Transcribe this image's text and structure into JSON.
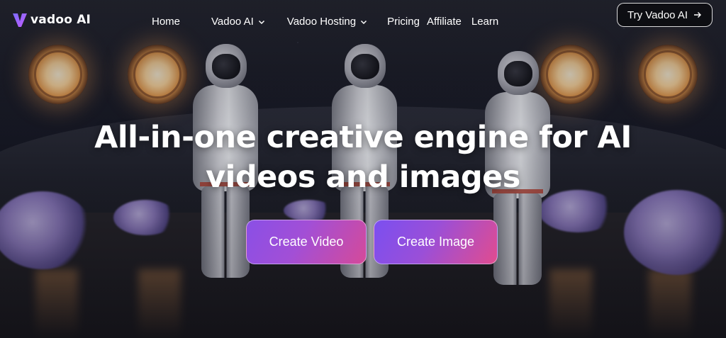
{
  "brand": {
    "name": "vadoo AI",
    "logo_icon": "vadoo-logo-icon",
    "accent_gradient": [
      "#7b4ff0",
      "#e14c8f"
    ]
  },
  "nav": {
    "items": [
      {
        "label": "Home",
        "dropdown": false
      },
      {
        "label": "Vadoo AI",
        "dropdown": true,
        "icon": "chevron-down-icon"
      },
      {
        "label": "Vadoo Hosting",
        "dropdown": true,
        "icon": "chevron-down-icon"
      },
      {
        "label": "Pricing",
        "dropdown": false
      },
      {
        "label": "Affiliate",
        "dropdown": false
      },
      {
        "label": "Learn",
        "dropdown": false
      }
    ],
    "cta": {
      "label": "Try Vadoo AI",
      "icon": "arrow-right-icon"
    }
  },
  "hero": {
    "headline_line1": "All-in-one creative engine for AI",
    "headline_line2": "videos and images",
    "buttons": {
      "video": "Create Video",
      "image": "Create Image"
    },
    "background": "astronauts-walking-scene"
  }
}
